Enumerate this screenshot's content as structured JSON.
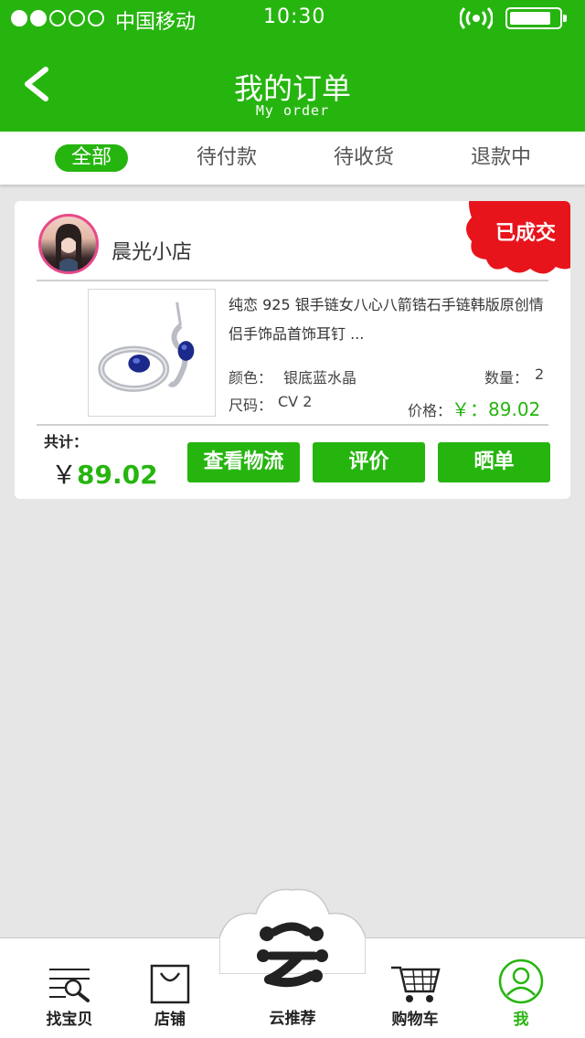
{
  "status_bar": {
    "carrier": "中国移动",
    "time": "10:30",
    "battery_level": 0.85
  },
  "header": {
    "title": "我的订单",
    "subtitle": "My order",
    "back_icon": "chevron-left-icon"
  },
  "tabs": [
    {
      "label": "全部",
      "active": true
    },
    {
      "label": "待付款",
      "active": false
    },
    {
      "label": "待收货",
      "active": false
    },
    {
      "label": "退款中",
      "active": false
    }
  ],
  "order": {
    "shop_name": "晨光小店",
    "status": "已成交",
    "product": {
      "description": "纯恋 925 银手链女八心八箭锆石手链韩版原创情侣手饰品首饰耳钉 ...",
      "color_label": "颜色：",
      "color_value": "银底蓝水晶",
      "quantity_label": "数量：",
      "quantity_value": "2",
      "size_label": "尺码：",
      "size_value": "CV 2",
      "price_label": "价格：",
      "price_value": "￥：89.02"
    },
    "total_label": "共计：",
    "total_currency": "￥",
    "total_value": "89.02",
    "buttons": {
      "logistics": "查看物流",
      "review": "评价",
      "share": "晒单"
    }
  },
  "tabbar": [
    {
      "label": "找宝贝",
      "icon": "search-list-icon",
      "active": false
    },
    {
      "label": "店铺",
      "icon": "shopping-bag-icon",
      "active": false
    },
    {
      "label": "云推荐",
      "icon": "yun-logo-icon",
      "active": false
    },
    {
      "label": "购物车",
      "icon": "cart-icon",
      "active": false
    },
    {
      "label": "我",
      "icon": "user-icon",
      "active": true
    }
  ],
  "colors": {
    "brand_green": "#26b50f",
    "status_red": "#e8141c",
    "background": "#e6e6e6"
  }
}
